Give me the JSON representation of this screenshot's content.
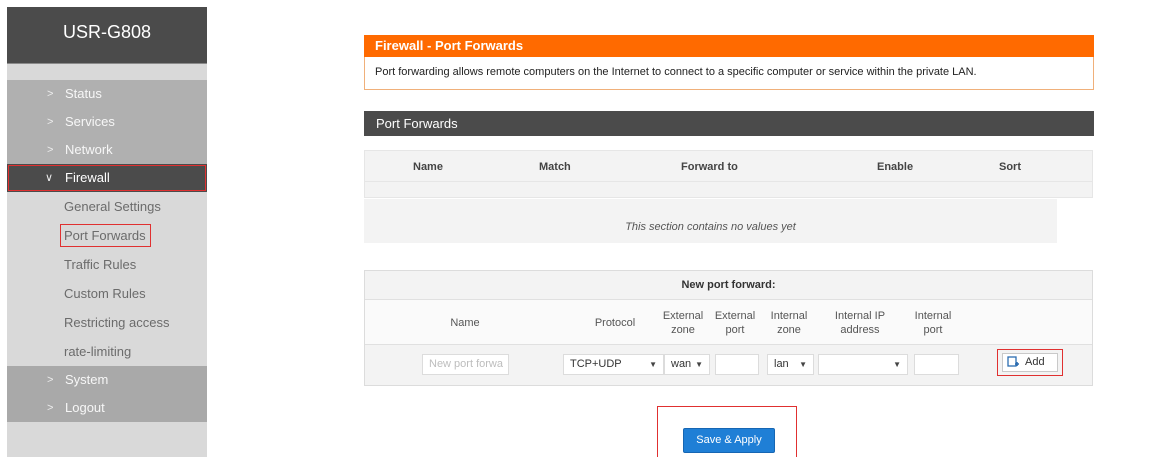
{
  "sidebar": {
    "brand": "USR-G808",
    "top_items": [
      "Status",
      "Services",
      "Network"
    ],
    "active_item": "Firewall",
    "sub_items": [
      "General Settings",
      "Port Forwards",
      "Traffic Rules",
      "Custom Rules",
      "Restricting access",
      "rate-limiting"
    ],
    "selected_sub_item": "Port Forwards",
    "bottom_items": [
      "System",
      "Logout"
    ],
    "chevron_right": ">",
    "chevron_down": "∨"
  },
  "main": {
    "title": "Firewall - Port Forwards",
    "description": "Port forwarding allows remote computers on the Internet to connect to a specific computer or service within the private LAN.",
    "section_title": "Port Forwards",
    "table_headers": [
      "Name",
      "Match",
      "Forward to",
      "Enable",
      "Sort"
    ],
    "empty_message": "This section contains no values yet",
    "new_forward": {
      "title": "New port forward:",
      "columns": [
        "Name",
        "Protocol",
        "External zone",
        "External port",
        "Internal zone",
        "Internal IP address",
        "Internal port"
      ],
      "name_placeholder": "New port forwa",
      "protocol": "TCP+UDP",
      "external_zone": "wan",
      "external_port": "",
      "internal_zone": "lan",
      "internal_ip": "",
      "internal_port": "",
      "add_label": "Add"
    },
    "save_apply_label": "Save & Apply"
  },
  "colors": {
    "accent_orange": "#ff6a00",
    "dark_header": "#4b4b4b",
    "button_blue": "#1f7fd6",
    "highlight_red": "#e03030"
  }
}
